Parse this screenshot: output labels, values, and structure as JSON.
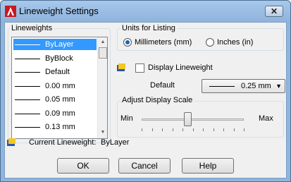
{
  "window": {
    "title": "Lineweight Settings",
    "close_glyph": "✕"
  },
  "lineweights": {
    "group_label": "Lineweights",
    "items": [
      {
        "label": "ByLayer",
        "selected": true
      },
      {
        "label": "ByBlock",
        "selected": false
      },
      {
        "label": "Default",
        "selected": false
      },
      {
        "label": "0.00 mm",
        "selected": false
      },
      {
        "label": "0.05 mm",
        "selected": false
      },
      {
        "label": "0.09 mm",
        "selected": false
      },
      {
        "label": "0.13 mm",
        "selected": false
      }
    ]
  },
  "units": {
    "group_label": "Units for Listing",
    "millimeters_label": "Millimeters (mm)",
    "millimeters_checked": true,
    "inches_label": "Inches (in)",
    "inches_checked": false
  },
  "display_lineweight": {
    "label": "Display Lineweight",
    "checked": false
  },
  "default": {
    "label": "Default",
    "value": "0.25 mm"
  },
  "scale": {
    "group_label": "Adjust Display Scale",
    "min_label": "Min",
    "max_label": "Max",
    "level": 0.45
  },
  "current": {
    "label": "Current Lineweight:",
    "value": "ByLayer"
  },
  "buttons": {
    "ok": "OK",
    "cancel": "Cancel",
    "help": "Help"
  },
  "colors": {
    "titlebar": "#8fb5dc",
    "selection": "#3399ff",
    "dialog_bg": "#f0f0f0"
  },
  "icons": {
    "app": "autocad-logo-icon",
    "pane": "layer-pane-icon",
    "close": "close-icon"
  }
}
